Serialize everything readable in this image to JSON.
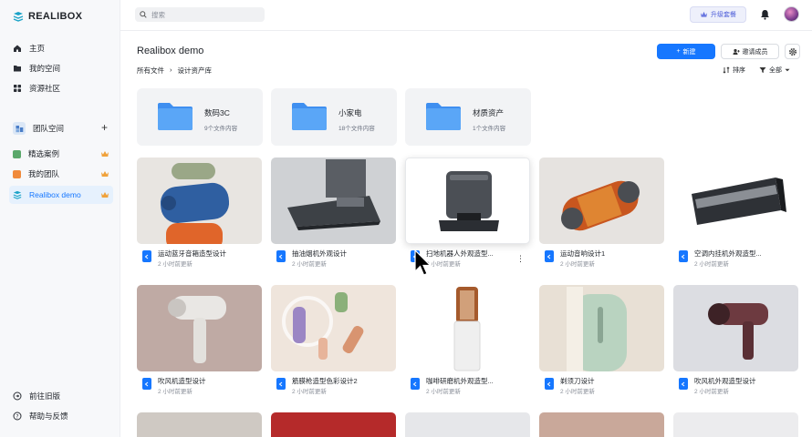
{
  "app": {
    "logo": "REALIBOX"
  },
  "sidebar": {
    "nav": [
      {
        "label": "主页",
        "icon": "home-icon"
      },
      {
        "label": "我的空间",
        "icon": "folder-icon"
      },
      {
        "label": "资源社区",
        "icon": "grid-icon"
      }
    ],
    "team_section": {
      "label": "团队空间",
      "add_icon": "plus-icon"
    },
    "teams": [
      {
        "label": "精选案例",
        "icon": "team-avatar-icon",
        "premium": true,
        "active": false
      },
      {
        "label": "我的团队",
        "icon": "team-avatar-icon",
        "premium": true,
        "active": false
      },
      {
        "label": "Realibox demo",
        "icon": "realibox-logo-icon",
        "premium": true,
        "active": true
      }
    ],
    "footer": [
      {
        "label": "前往旧版",
        "icon": "arrow-circle-icon"
      },
      {
        "label": "帮助与反馈",
        "icon": "question-circle-icon"
      }
    ]
  },
  "header": {
    "search_placeholder": "搜索",
    "upgrade_label": "升级套餐",
    "bell_icon": "bell-icon"
  },
  "main": {
    "title": "Realibox demo",
    "breadcrumb": [
      "所有文件",
      "设计资产库"
    ],
    "breadcrumb_sep": "›",
    "new_button": "新建",
    "invite_button": "邀请成员",
    "sort_label": "排序",
    "filter_label": "全部",
    "folders": [
      {
        "name": "数码3C",
        "count": "9个文件内容"
      },
      {
        "name": "小家电",
        "count": "18个文件内容"
      },
      {
        "name": "材质资产",
        "count": "1个文件内容"
      }
    ],
    "files": [
      {
        "name": "运动蓝牙音箱造型设计",
        "time": "2 小时前更新"
      },
      {
        "name": "抽油烟机外观设计",
        "time": "2 小时前更新"
      },
      {
        "name": "扫地机器人外观造型...",
        "time": "2 小时前更新"
      },
      {
        "name": "运动音响设计1",
        "time": "2 小时前更新"
      },
      {
        "name": "空调内挂机外观造型...",
        "time": "2 小时前更新"
      },
      {
        "name": "吹风机造型设计",
        "time": "2 小时前更新"
      },
      {
        "name": "筋膜枪造型色彩设计2",
        "time": "2 小时前更新"
      },
      {
        "name": "咖啡研磨机外观造型...",
        "time": "2 小时前更新"
      },
      {
        "name": "剃须刀设计",
        "time": "2 小时前更新"
      },
      {
        "name": "吹风机外观造型设计",
        "time": "2 小时前更新"
      }
    ]
  },
  "colors": {
    "accent": "#1677ff",
    "folder": "#4a9cf5",
    "premium": "#f0a23b"
  }
}
